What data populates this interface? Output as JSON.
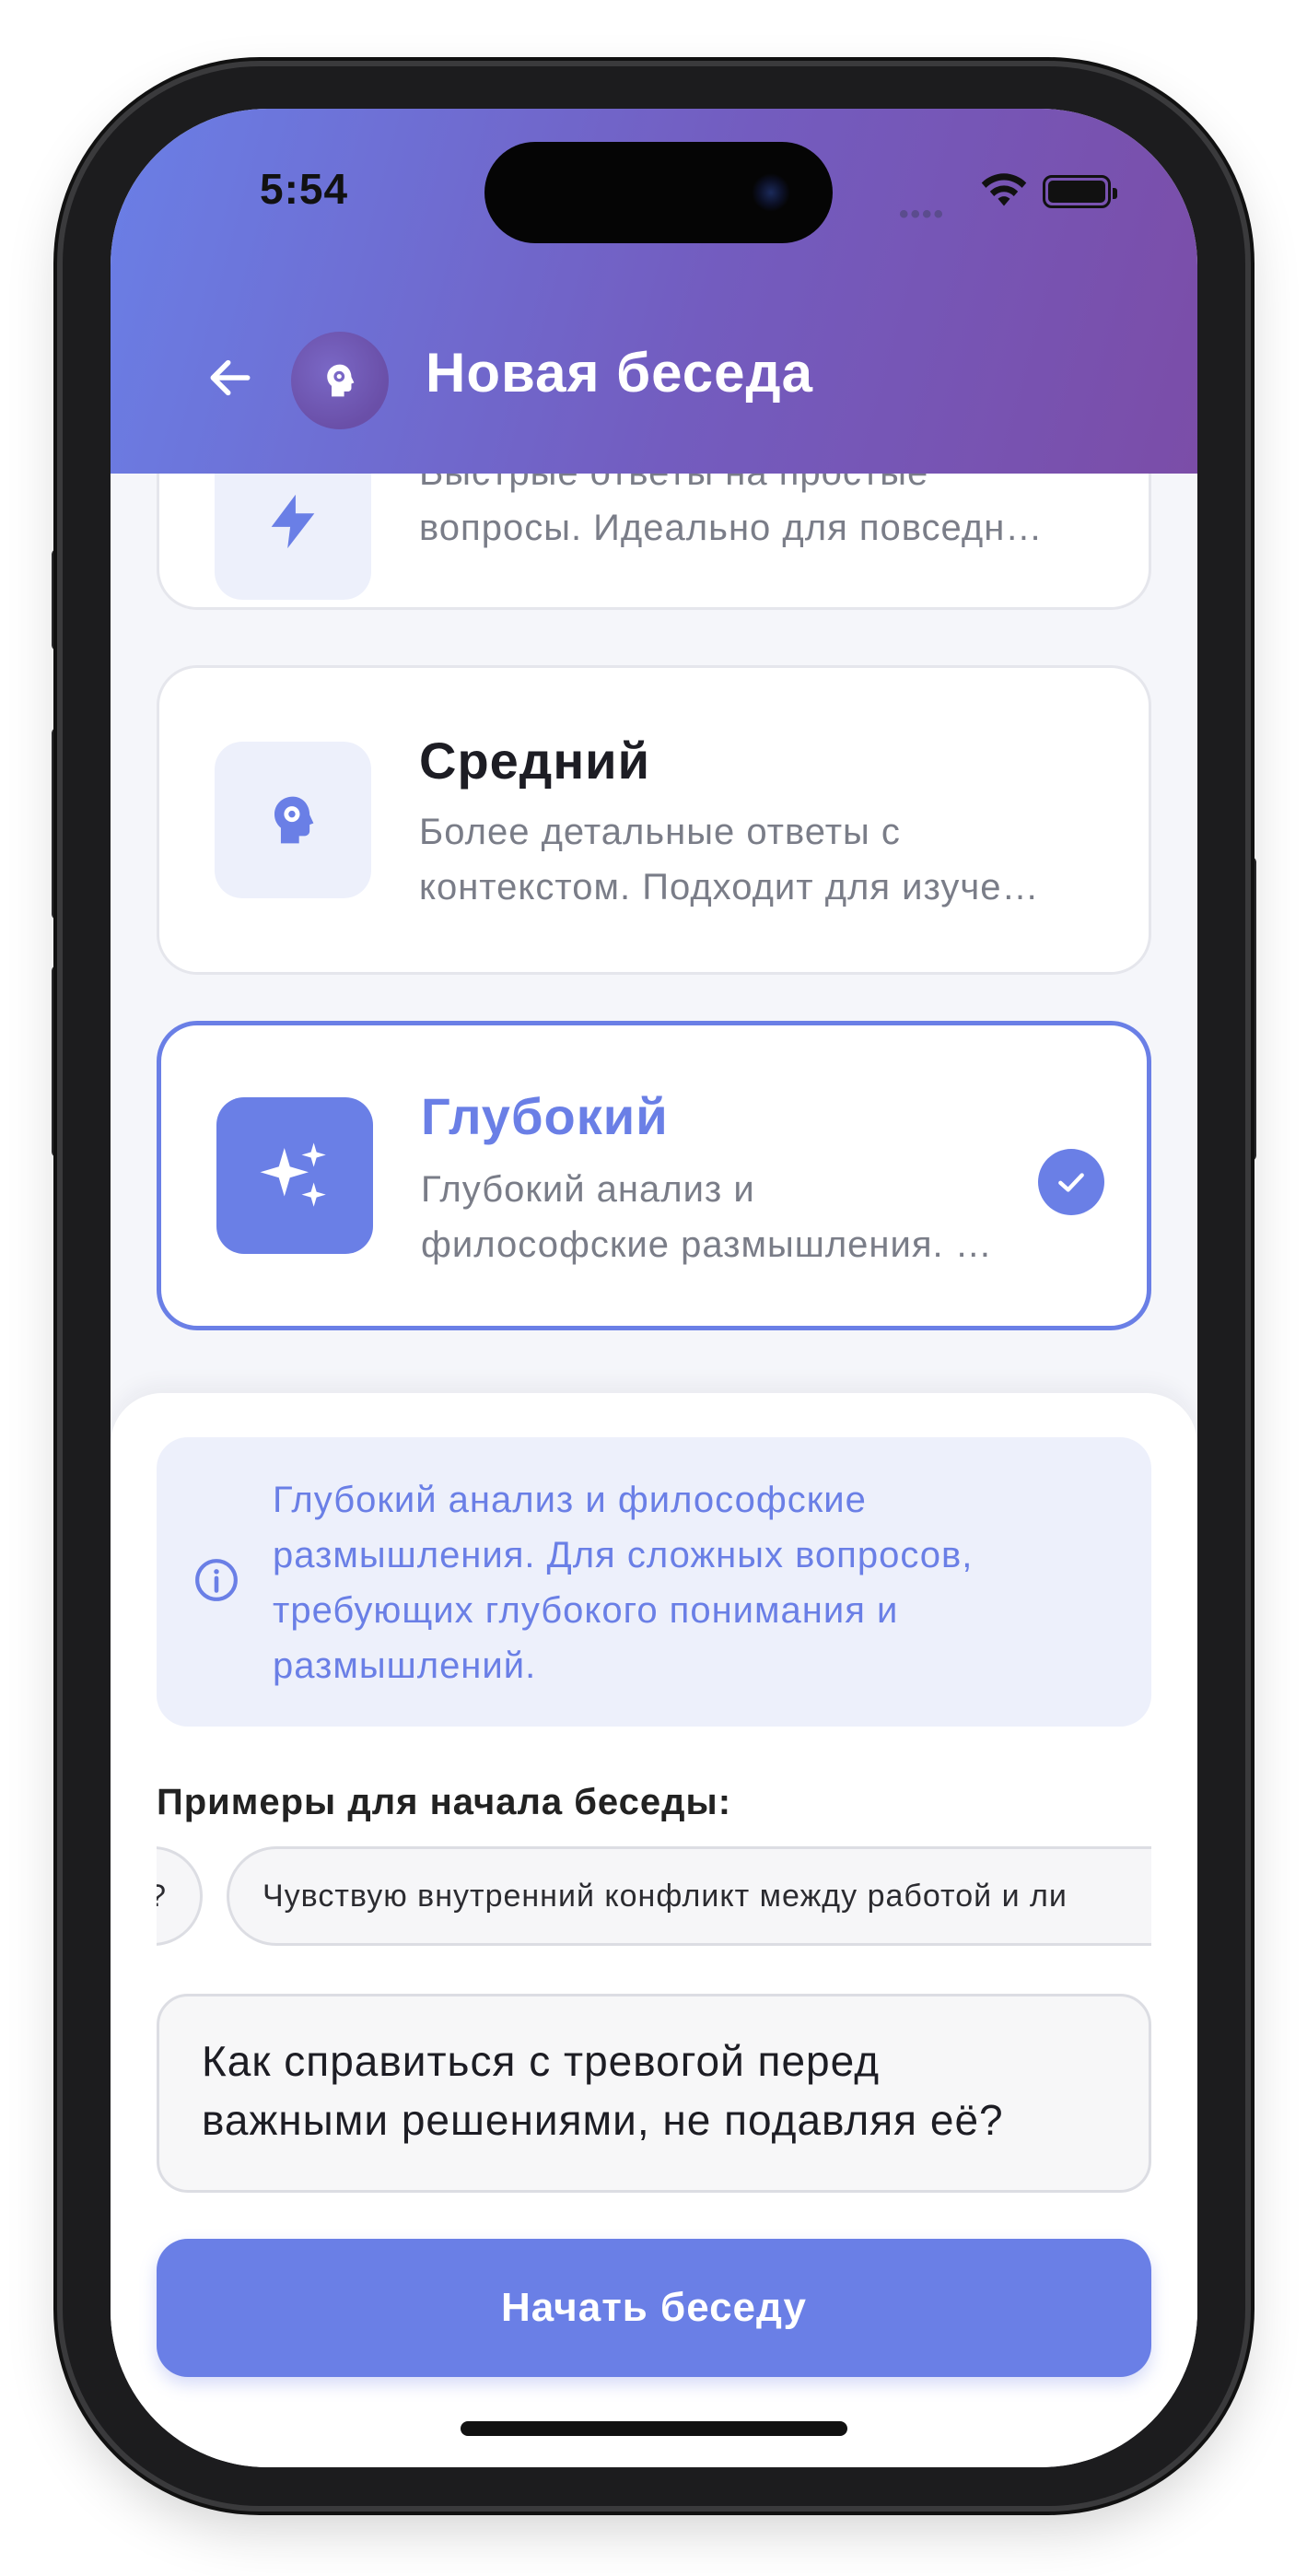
{
  "status_bar": {
    "time": "5:54",
    "signal": "••••",
    "icons": [
      "wifi-icon",
      "battery-icon"
    ]
  },
  "header": {
    "title": "Новая беседа",
    "back_icon": "arrow-left-icon",
    "logo_icon": "head-gear-icon",
    "gradient": [
      "#6a7fe6",
      "#7b4da8"
    ]
  },
  "modes": [
    {
      "id": "quick",
      "title": "",
      "description_lines": [
        "Быстрые ответы на простые",
        "вопросы. Идеально для повседн…"
      ],
      "icon": "lightning-icon",
      "selected": false
    },
    {
      "id": "medium",
      "title": "Средний",
      "description_lines": [
        "Более детальные ответы с",
        "контекстом. Подходит для изуче…"
      ],
      "icon": "head-gear-icon",
      "selected": false
    },
    {
      "id": "deep",
      "title": "Глубокий",
      "description_lines": [
        "Глубокий анализ и",
        "философские размышления. …"
      ],
      "icon": "sparkles-icon",
      "selected": true,
      "check_icon": "checkmark-icon"
    }
  ],
  "info": {
    "icon": "info-icon",
    "lines": [
      "Глубокий анализ и философские",
      "размышления. Для сложных вопросов,",
      "требующих глубокого понимания и",
      "размышлений."
    ]
  },
  "examples": {
    "title": "Примеры для начала беседы:",
    "chips": [
      "?",
      "Чувствую внутренний конфликт между работой и ли"
    ]
  },
  "input": {
    "lines": [
      "Как справиться с тревогой перед",
      "важными решениями, не подавляя её?"
    ]
  },
  "start_button": {
    "label": "Начать беседу"
  },
  "colors": {
    "accent": "#6a7fe6",
    "accent_light": "#edf0fb",
    "background": "#f5f6fa",
    "text_primary": "#1d1d24",
    "text_secondary": "#7a7d88"
  }
}
